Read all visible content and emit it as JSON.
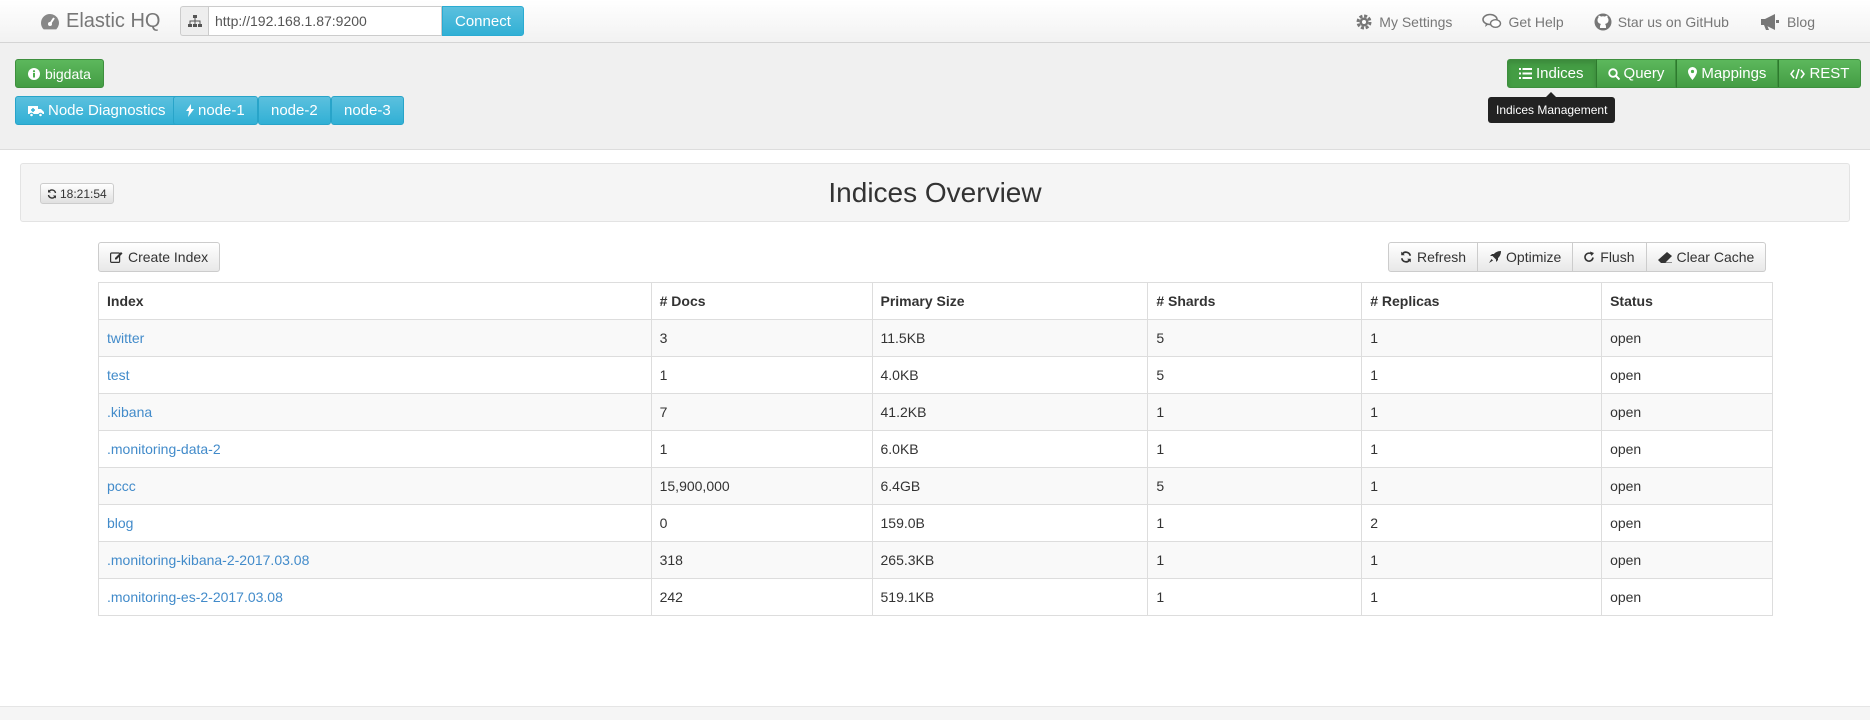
{
  "navbar": {
    "brand": "Elastic HQ",
    "url_value": "http://192.168.1.87:9200",
    "connect_label": "Connect",
    "links": [
      {
        "label": "My Settings",
        "icon": "gear-icon"
      },
      {
        "label": "Get Help",
        "icon": "chat-icon"
      },
      {
        "label": "Star us on GitHub",
        "icon": "github-icon"
      },
      {
        "label": "Blog",
        "icon": "bullhorn-icon"
      }
    ]
  },
  "cluster": {
    "name": "bigdata",
    "node_diagnostics_label": "Node Diagnostics",
    "nodes": [
      "node-1",
      "node-2",
      "node-3"
    ]
  },
  "tabs": {
    "indices": "Indices",
    "query": "Query",
    "mappings": "Mappings",
    "rest": "REST",
    "active": "indices"
  },
  "tooltip": "Indices Management",
  "overview": {
    "refresh_time": "18:21:54",
    "title": "Indices Overview"
  },
  "toolbar": {
    "create_index": "Create Index",
    "refresh": "Refresh",
    "optimize": "Optimize",
    "flush": "Flush",
    "clear_cache": "Clear Cache"
  },
  "table": {
    "headers": {
      "index": "Index",
      "docs": "# Docs",
      "size": "Primary Size",
      "shards": "# Shards",
      "replicas": "# Replicas",
      "status": "Status"
    },
    "rows": [
      {
        "index": "twitter",
        "docs": "3",
        "size": "11.5KB",
        "shards": "5",
        "replicas": "1",
        "status": "open"
      },
      {
        "index": "test",
        "docs": "1",
        "size": "4.0KB",
        "shards": "5",
        "replicas": "1",
        "status": "open"
      },
      {
        "index": ".kibana",
        "docs": "7",
        "size": "41.2KB",
        "shards": "1",
        "replicas": "1",
        "status": "open"
      },
      {
        "index": ".monitoring-data-2",
        "docs": "1",
        "size": "6.0KB",
        "shards": "1",
        "replicas": "1",
        "status": "open"
      },
      {
        "index": "pccc",
        "docs": "15,900,000",
        "size": "6.4GB",
        "shards": "5",
        "replicas": "1",
        "status": "open"
      },
      {
        "index": "blog",
        "docs": "0",
        "size": "159.0B",
        "shards": "1",
        "replicas": "2",
        "status": "open"
      },
      {
        "index": ".monitoring-kibana-2-2017.03.08",
        "docs": "318",
        "size": "265.3KB",
        "shards": "1",
        "replicas": "1",
        "status": "open"
      },
      {
        "index": ".monitoring-es-2-2017.03.08",
        "docs": "242",
        "size": "519.1KB",
        "shards": "1",
        "replicas": "1",
        "status": "open"
      }
    ]
  }
}
